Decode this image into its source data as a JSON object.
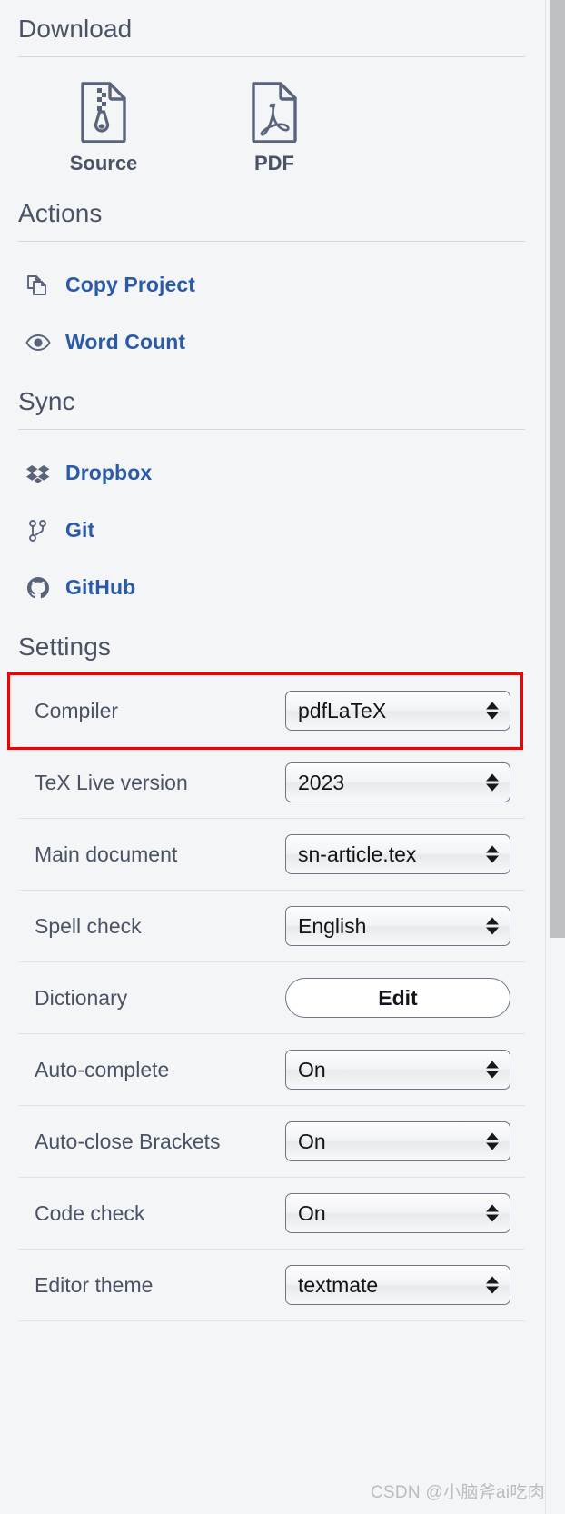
{
  "download": {
    "title": "Download",
    "items": [
      {
        "label": "Source",
        "icon": "zip-file-icon"
      },
      {
        "label": "PDF",
        "icon": "pdf-file-icon"
      }
    ]
  },
  "actions": {
    "title": "Actions",
    "items": [
      {
        "label": "Copy Project",
        "icon": "copy-icon"
      },
      {
        "label": "Word Count",
        "icon": "eye-icon"
      }
    ]
  },
  "sync": {
    "title": "Sync",
    "items": [
      {
        "label": "Dropbox",
        "icon": "dropbox-icon"
      },
      {
        "label": "Git",
        "icon": "git-branch-icon"
      },
      {
        "label": "GitHub",
        "icon": "github-icon"
      }
    ]
  },
  "settings": {
    "title": "Settings",
    "rows": [
      {
        "label": "Compiler",
        "control": "select",
        "value": "pdfLaTeX",
        "highlighted": true
      },
      {
        "label": "TeX Live version",
        "control": "select",
        "value": "2023"
      },
      {
        "label": "Main document",
        "control": "select",
        "value": "sn-article.tex"
      },
      {
        "label": "Spell check",
        "control": "select",
        "value": "English"
      },
      {
        "label": "Dictionary",
        "control": "button",
        "value": "Edit"
      },
      {
        "label": "Auto-complete",
        "control": "select",
        "value": "On"
      },
      {
        "label": "Auto-close Brackets",
        "control": "select",
        "value": "On"
      },
      {
        "label": "Code check",
        "control": "select",
        "value": "On"
      },
      {
        "label": "Editor theme",
        "control": "select",
        "value": "textmate"
      }
    ]
  },
  "watermark": "CSDN @小脑斧ai吃肉",
  "colors": {
    "link": "#2a5aa8",
    "text": "#4a5366",
    "highlight": "#f50000",
    "background": "#f4f5f6"
  }
}
